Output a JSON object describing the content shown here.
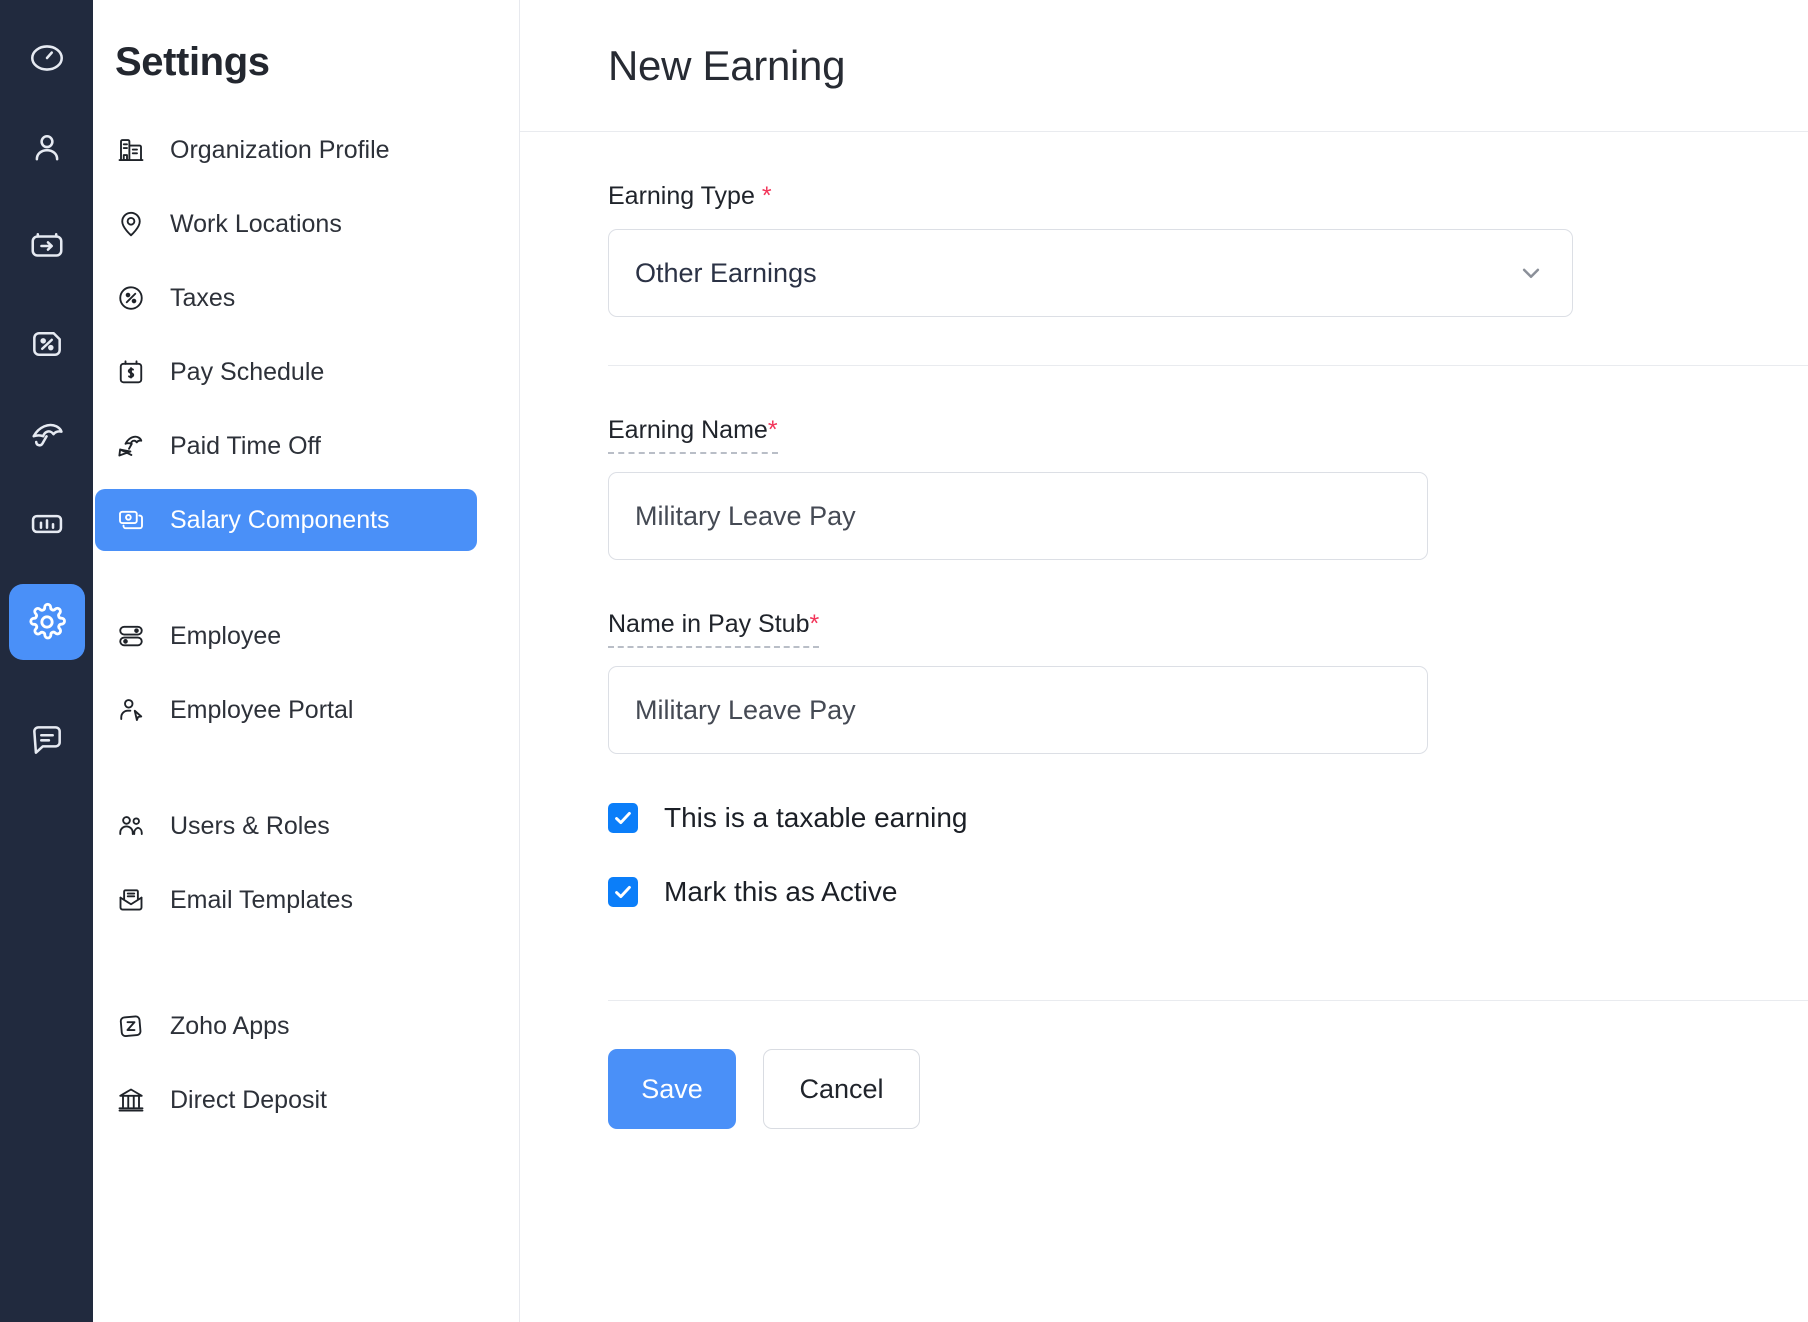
{
  "rail": {
    "items": [
      {
        "name": "dashboard-icon",
        "icon": "speedometer",
        "active": false
      },
      {
        "name": "employees-icon",
        "icon": "person",
        "active": false
      },
      {
        "name": "pay-runs-icon",
        "icon": "arrow-in-box",
        "active": false
      },
      {
        "name": "taxes-icon",
        "icon": "percent-box",
        "active": false
      },
      {
        "name": "time-off-icon",
        "icon": "umbrella",
        "active": false
      },
      {
        "name": "reports-icon",
        "icon": "bar-chart",
        "active": false
      },
      {
        "name": "settings-icon",
        "icon": "gear",
        "active": true
      },
      {
        "name": "chat-icon",
        "icon": "chat",
        "active": false
      }
    ]
  },
  "sidebar": {
    "title": "Settings",
    "groups": [
      {
        "items": [
          {
            "label": "Organization Profile",
            "icon": "building",
            "selected": false
          },
          {
            "label": "Work Locations",
            "icon": "map-pin",
            "selected": false
          },
          {
            "label": "Taxes",
            "icon": "percent",
            "selected": false
          },
          {
            "label": "Pay Schedule",
            "icon": "calendar-dollar",
            "selected": false
          },
          {
            "label": "Paid Time Off",
            "icon": "umbrella-chair",
            "selected": false
          },
          {
            "label": "Salary Components",
            "icon": "money-cards",
            "selected": true
          }
        ]
      },
      {
        "items": [
          {
            "label": "Employee",
            "icon": "toggles",
            "selected": false
          },
          {
            "label": "Employee Portal",
            "icon": "person-cursor",
            "selected": false
          }
        ]
      },
      {
        "items": [
          {
            "label": "Users & Roles",
            "icon": "users",
            "selected": false
          },
          {
            "label": "Email Templates",
            "icon": "envelope",
            "selected": false
          }
        ]
      },
      {
        "items": [
          {
            "label": "Zoho Apps",
            "icon": "zoho-z",
            "selected": false
          },
          {
            "label": "Direct Deposit",
            "icon": "bank",
            "selected": false
          }
        ]
      }
    ]
  },
  "main": {
    "title": "New Earning",
    "earning_type": {
      "label": "Earning Type",
      "required_mark": "*",
      "value": "Other Earnings"
    },
    "earning_name": {
      "label": "Earning Name",
      "required_mark": "*",
      "value": "Military Leave Pay",
      "placeholder": "Military Leave Pay"
    },
    "pay_stub_name": {
      "label": "Name in Pay Stub",
      "required_mark": "*",
      "value": "Military Leave Pay",
      "placeholder": "Military Leave Pay"
    },
    "checkboxes": [
      {
        "label": "This is a taxable earning",
        "checked": true
      },
      {
        "label": "Mark this as Active",
        "checked": true
      }
    ],
    "buttons": {
      "save": "Save",
      "cancel": "Cancel"
    }
  },
  "colors": {
    "accent_blue": "#4a90f8",
    "checkbox_blue": "#0b7ef9",
    "rail_navy": "#212a3e",
    "required_red": "#f2355a"
  }
}
